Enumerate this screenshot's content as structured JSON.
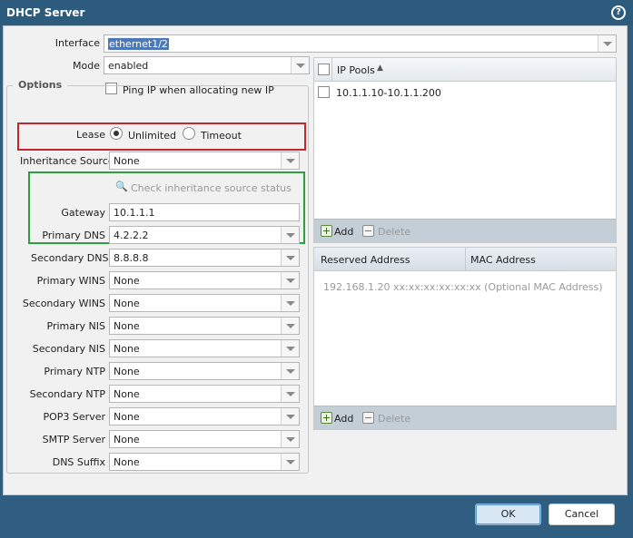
{
  "window": {
    "title": "DHCP Server",
    "help_icon": "?"
  },
  "interface": {
    "label": "Interface",
    "value": "ethernet1/2"
  },
  "mode": {
    "label": "Mode",
    "value": "enabled"
  },
  "ping": {
    "label": "Ping IP when allocating new IP",
    "checked": false
  },
  "options": {
    "legend": "Options",
    "lease": {
      "label": "Lease",
      "choices": [
        "Unlimited",
        "Timeout"
      ],
      "selected": "Unlimited"
    },
    "inheritance_source": {
      "label": "Inheritance Source",
      "value": "None"
    },
    "check_status": "Check inheritance source status",
    "gateway": {
      "label": "Gateway",
      "value": "10.1.1.1"
    },
    "primary_dns": {
      "label": "Primary DNS",
      "value": "4.2.2.2"
    },
    "secondary_dns": {
      "label": "Secondary DNS",
      "value": "8.8.8.8"
    },
    "primary_wins": {
      "label": "Primary WINS",
      "value": "None"
    },
    "secondary_wins": {
      "label": "Secondary WINS",
      "value": "None"
    },
    "primary_nis": {
      "label": "Primary NIS",
      "value": "None"
    },
    "secondary_nis": {
      "label": "Secondary NIS",
      "value": "None"
    },
    "primary_ntp": {
      "label": "Primary NTP",
      "value": "None"
    },
    "secondary_ntp": {
      "label": "Secondary NTP",
      "value": "None"
    },
    "pop3_server": {
      "label": "POP3 Server",
      "value": "None"
    },
    "smtp_server": {
      "label": "SMTP Server",
      "value": "None"
    },
    "dns_suffix": {
      "label": "DNS Suffix",
      "value": "None"
    }
  },
  "ip_pools": {
    "header": "IP Pools",
    "rows": [
      "10.1.1.10-10.1.1.200"
    ],
    "add_label": "Add",
    "delete_label": "Delete"
  },
  "reserved": {
    "columns": [
      "Reserved Address",
      "MAC Address"
    ],
    "placeholder": "192.168.1.20 xx:xx:xx:xx:xx:xx (Optional MAC Address)",
    "add_label": "Add",
    "delete_label": "Delete"
  },
  "buttons": {
    "ok": "OK",
    "cancel": "Cancel"
  },
  "colors": {
    "titlebar": "#2c5b7e",
    "highlight_red": "#c0282d",
    "highlight_green": "#2ca040"
  }
}
